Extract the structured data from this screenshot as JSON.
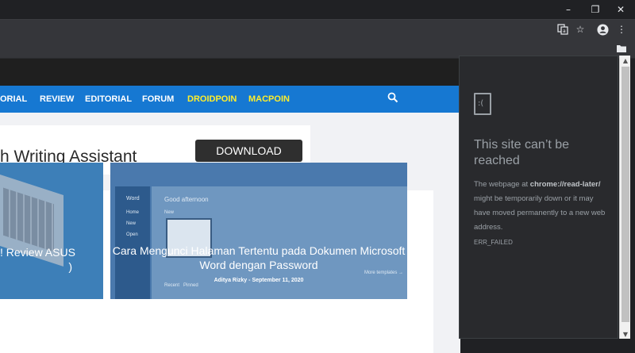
{
  "window": {
    "minimize_icon": "minimize-icon",
    "restore_icon": "restore-icon",
    "close_icon": "close-icon"
  },
  "toolbar": {
    "icons": [
      "translate-icon",
      "star-icon",
      "profile-icon",
      "menu-icon",
      "folder-icon"
    ]
  },
  "site_nav": {
    "items": [
      "ORIAL",
      "REVIEW",
      "EDITORIAL",
      "FORUM",
      "DROIDPOIN",
      "MACPOIN"
    ],
    "highlight_color": "#ffee2b",
    "bar_color": "#1678d2"
  },
  "ad": {
    "text": "h Writing Assistant",
    "button_label": "DOWNLOAD"
  },
  "cards": [
    {
      "title_line1": "! Review ASUS",
      "title_line2": ")"
    },
    {
      "title": "Cara Mengunci Halaman Tertentu pada Dokumen Microsoft Word dengan Password",
      "author": "Aditya Rizky",
      "separator": "-",
      "date": "September 11, 2020",
      "screenshot_labels": {
        "app": "Word",
        "greeting": "Good afternoon",
        "new": "New",
        "home": "Home",
        "open": "Open",
        "recent": "Recent",
        "pinned": "Pinned",
        "more_templates": "More templates →"
      }
    }
  ],
  "error_panel": {
    "heading": "This site can’t be reached",
    "body_prefix": "The webpage at ",
    "url": "chrome://read-later/",
    "body_suffix": " might be temporarily down or it may have moved permanently to a new web address.",
    "error_code": "ERR_FAILED"
  }
}
